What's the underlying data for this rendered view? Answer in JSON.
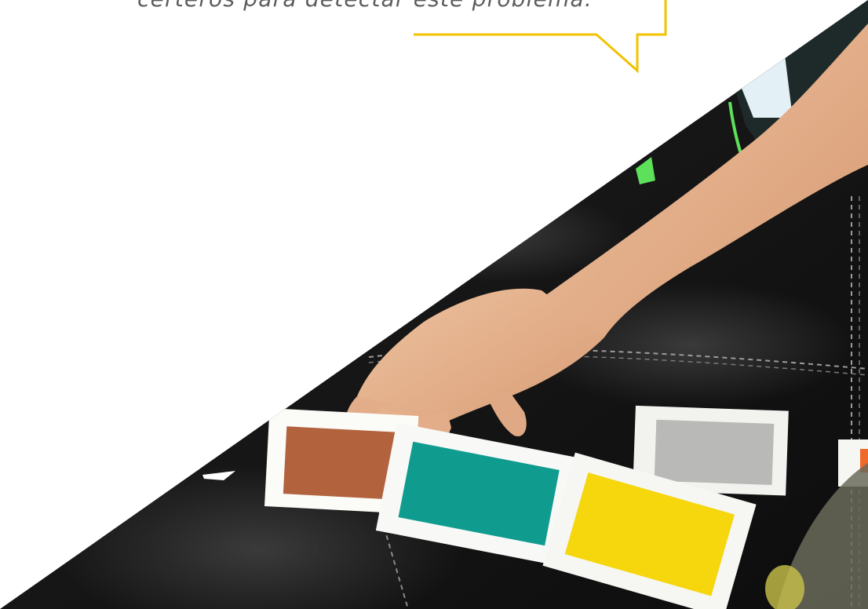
{
  "caption": {
    "text": "certeros para detectar este problema."
  },
  "colors": {
    "bubble_outline": "#f2c200",
    "background": "#ffffff",
    "caption_text": "#5c5c5c",
    "leather": "#1b1b1b",
    "card_brown": "#b2633e",
    "card_teal": "#0f9c8f",
    "card_gray": "#b9bab7",
    "card_yellow": "#f6d60c",
    "card_orange": "#ee6a2a",
    "skin": "#e7b48e",
    "sleeve": "#e3f0f6",
    "green_accent": "#5ee15a"
  },
  "photo": {
    "subject": "child-hand-on-color-cards",
    "card_colors": [
      "brown",
      "teal",
      "gray",
      "yellow",
      "orange"
    ]
  }
}
